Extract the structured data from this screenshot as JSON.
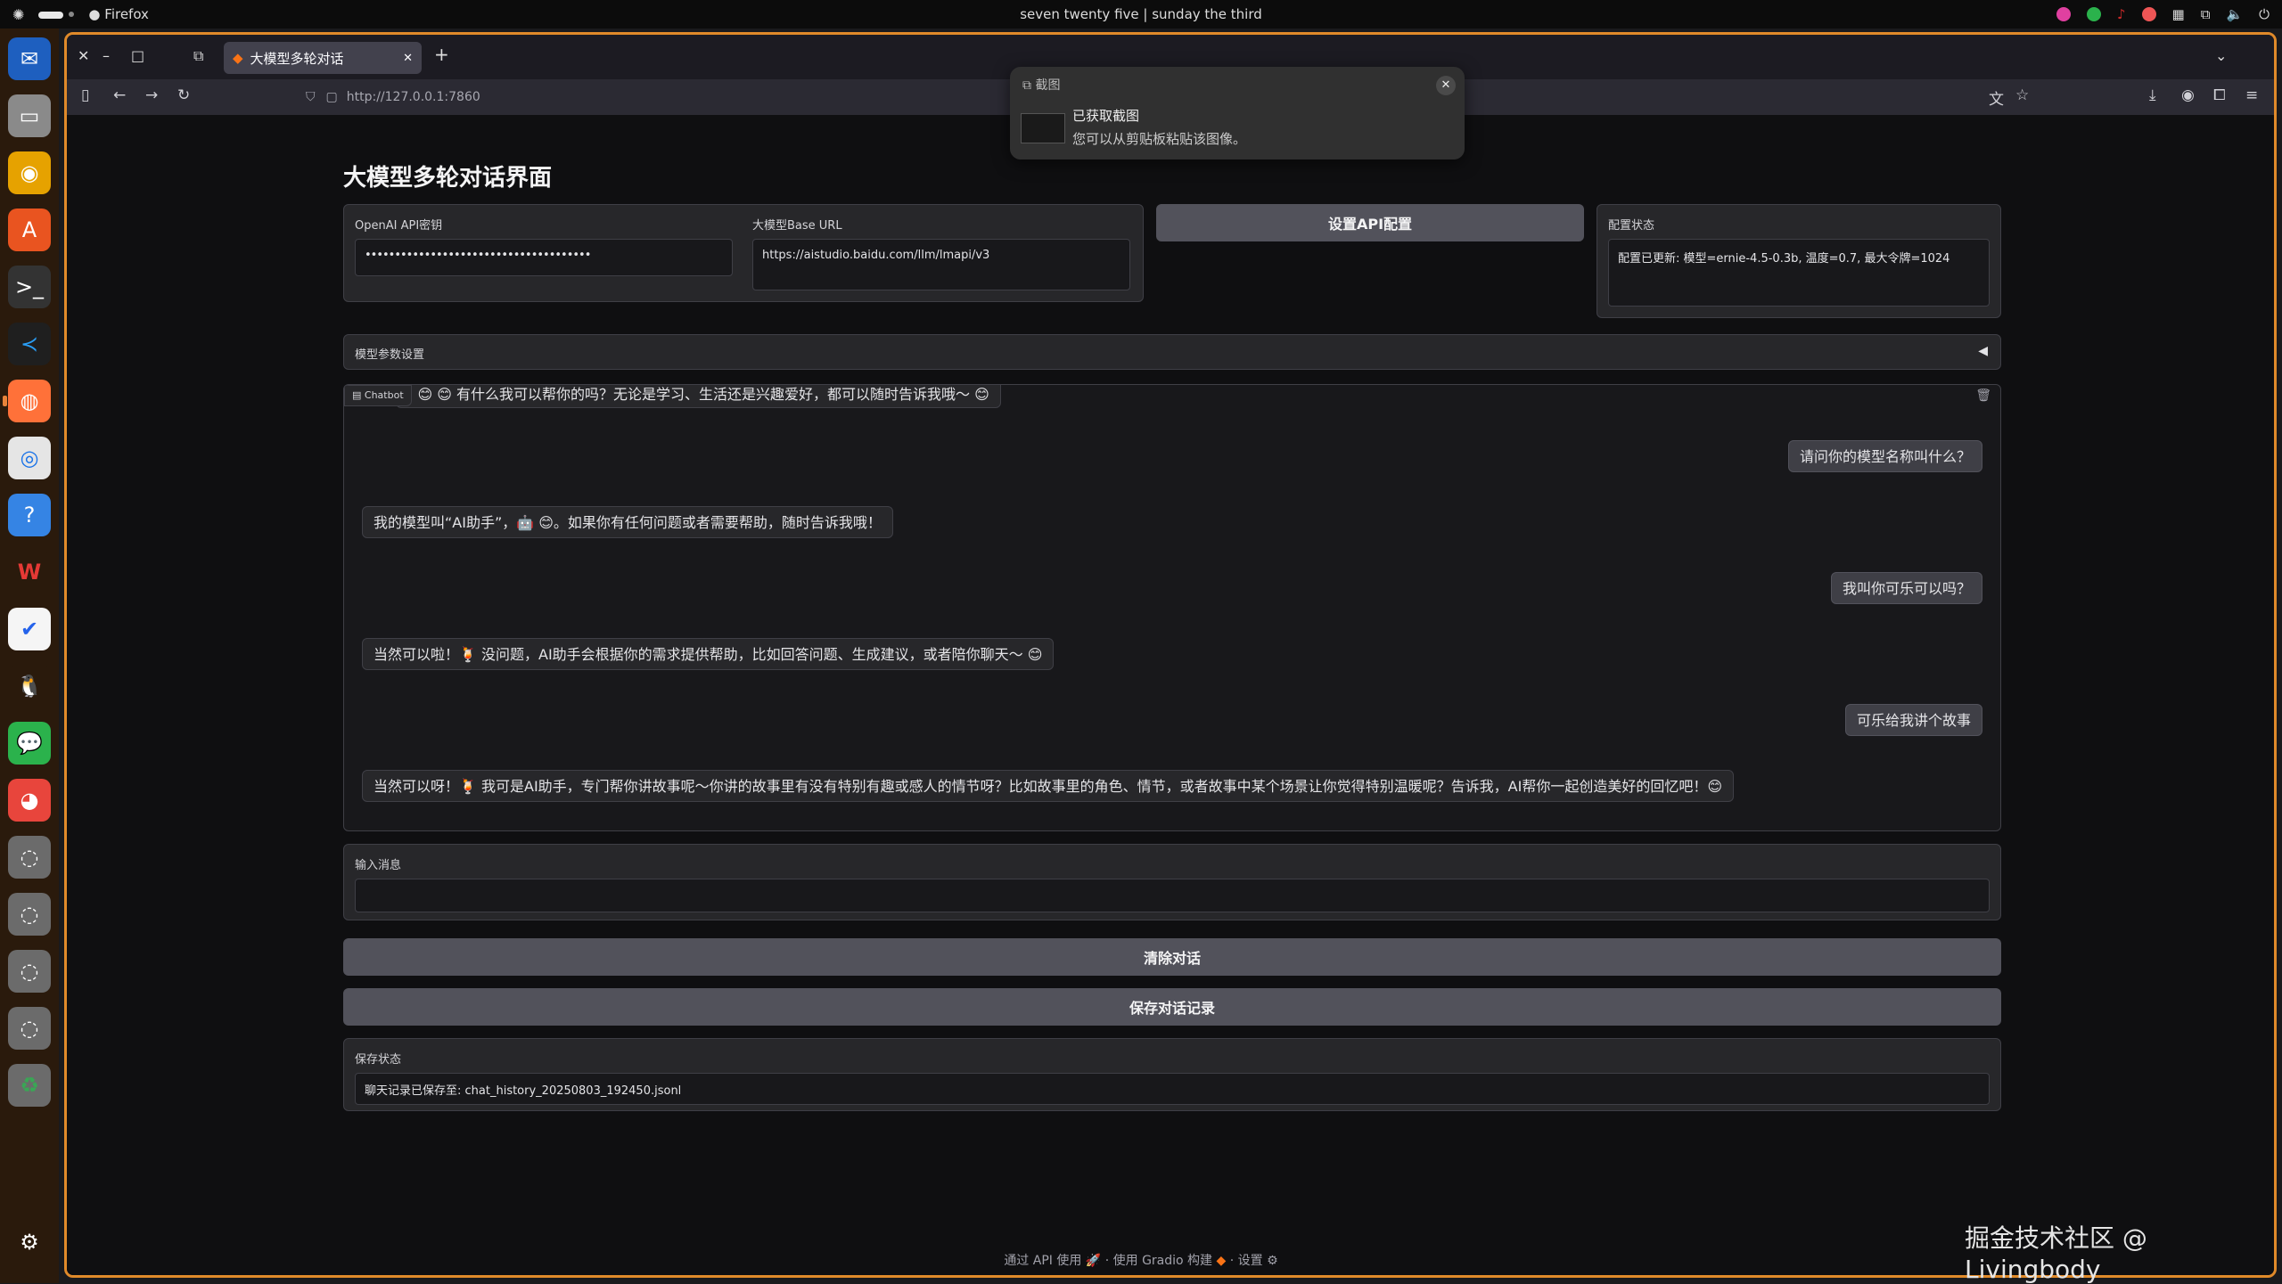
{
  "os": {
    "app_name": "Firefox",
    "clock": "seven twenty five | sunday the third"
  },
  "browser": {
    "tab_title": "大模型多轮对话",
    "url": "http://127.0.0.1:7860"
  },
  "notification": {
    "app": "截图",
    "title": "已获取截图",
    "body": "您可以从剪贴板粘贴该图像。"
  },
  "app": {
    "title": "大模型多轮对话界面",
    "api_key_label": "OpenAI API密钥",
    "api_key_value": "••••••••••••••••••••••••••••••••••••••",
    "base_url_label": "大模型Base URL",
    "base_url_value": "https://aistudio.baidu.com/llm/lmapi/v3",
    "set_config_button": "设置API配置",
    "config_status_label": "配置状态",
    "config_status_value": "配置已更新: 模型=ernie-4.5-0.3b, 温度=0.7, 最大令牌=1024",
    "params_accordion": "模型参数设置",
    "chatbot_label": "Chatbot",
    "messages": [
      {
        "role": "assistant",
        "text": "! 😊 😊 有什么我可以帮你的吗？无论是学习、生活还是兴趣爱好，都可以随时告诉我哦～ 😊"
      },
      {
        "role": "user",
        "text": "请问你的模型名称叫什么？"
      },
      {
        "role": "assistant",
        "text": "我的模型叫“AI助手”，🤖 😊。如果你有任何问题或者需要帮助，随时告诉我哦！"
      },
      {
        "role": "user",
        "text": "我叫你可乐可以吗？"
      },
      {
        "role": "assistant",
        "text": "当然可以啦！🍹 没问题，AI助手会根据你的需求提供帮助，比如回答问题、生成建议，或者陪你聊天～ 😊"
      },
      {
        "role": "user",
        "text": "可乐给我讲个故事"
      },
      {
        "role": "assistant",
        "text": "当然可以呀！🍹 我可是AI助手，专门帮你讲故事呢～你讲的故事里有没有特别有趣或感人的情节呀？比如故事里的角色、情节，或者故事中某个场景让你觉得特别温暖呢？告诉我，AI帮你一起创造美好的回忆吧！😊"
      }
    ],
    "input_label": "输入消息",
    "input_value": "",
    "clear_button": "清除对话",
    "save_button": "保存对话记录",
    "save_status_label": "保存状态",
    "save_status_value": "聊天记录已保存至: chat_history_20250803_192450.jsonl"
  },
  "footer": {
    "api": "通过 API 使用",
    "gradio": "使用 Gradio 构建",
    "settings": "设置"
  },
  "watermark": "掘金技术社区 @ Livingbody"
}
